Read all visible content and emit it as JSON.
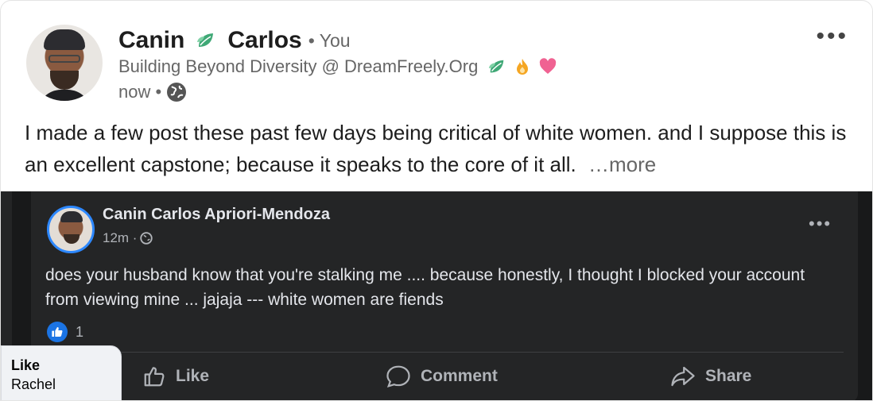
{
  "author": {
    "first_name": "Canin",
    "last_name": "Carlos",
    "relation": "• You",
    "headline": "Building Beyond Diversity @ DreamFreely.Org",
    "timestamp": "now •",
    "visibility_icon": "globe-icon"
  },
  "menu": {
    "more_label": "•••"
  },
  "post": {
    "text": "I made a few post these past few days being critical of white women. and I suppose this is an excellent capstone; because it speaks to the core of it all.",
    "see_more": "…more"
  },
  "embedded_post": {
    "author": "Canin Carlos Apriori-Mendoza",
    "timestamp": "12m ·",
    "text": "does your husband know that you're stalking me .... because honestly, I thought I blocked your account from viewing mine ... jajaja --- white women are fiends",
    "reaction_count": "1",
    "menu_label": "•••",
    "actions": {
      "like": "Like",
      "comment": "Comment",
      "share": "Share"
    }
  },
  "tooltip": {
    "title": "Like",
    "name": "Rachel"
  },
  "colors": {
    "dark_bg": "#18191a",
    "dark_card": "#242526",
    "facebook_blue": "#1b74e4",
    "leaf_green": "#3fa876",
    "heart_pink": "#f06292",
    "fire_orange": "#f5a623"
  }
}
